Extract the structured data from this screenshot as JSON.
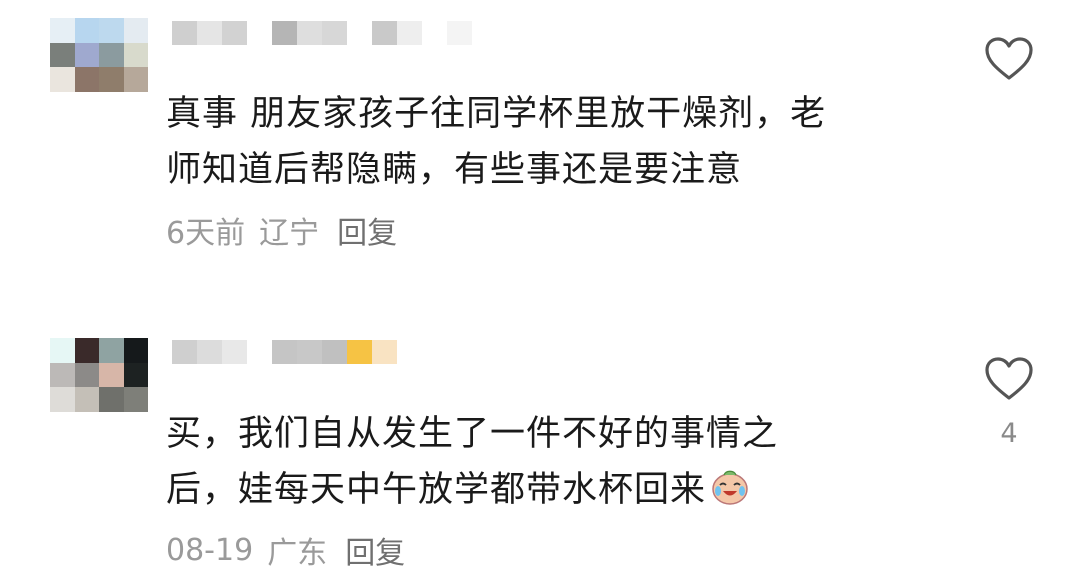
{
  "comments": [
    {
      "text_line1": "真事 朋友家孩子往同学杯里放干燥剂，老",
      "text_line2": "师知道后帮隐瞒，有些事还是要注意",
      "time": "6天前",
      "location": "辽宁",
      "reply_label": "回复",
      "like_count": "",
      "avatar_pixels": [
        "#e6eff5",
        "#b7d6ef",
        "#bdd9ee",
        "#e4ebf1",
        "#7a7f7b",
        "#9fa9cf",
        "#8b9b9f",
        "#d8dacc",
        "#eae5de",
        "#8c7568",
        "#8f7d6b",
        "#b6a89a"
      ],
      "username_pixels": [
        "#cfcfcf",
        "#e5e5e5",
        "#d2d2d2",
        "#ffffff",
        "#b5b5b5",
        "#dedede",
        "#d7d7d7",
        "#ffffff",
        "#c9c9c9",
        "#eeeeee",
        "#ffffff",
        "#f4f4f4"
      ]
    },
    {
      "text_line1": "买，我们自从发生了一件不好的事情之",
      "text_line2": "后，娃每天中午放学都带水杯回来",
      "time": "08-19",
      "location": "广东",
      "reply_label": "回复",
      "like_count": "4",
      "emoji": "crying-laughing-emoji",
      "avatar_pixels": [
        "#e6f7f5",
        "#3a2a2a",
        "#8fa3a2",
        "#15191b",
        "#bcb9b7",
        "#8c8a88",
        "#d7b6a8",
        "#1d2222",
        "#dedcd8",
        "#c4bfb7",
        "#6f706b",
        "#7e7f79"
      ],
      "username_pixels": [
        "#cfcfcf",
        "#dcdcdc",
        "#e8e8e8",
        "#ffffff",
        "#c5c5c5",
        "#c8c8c8",
        "#c0c0c0",
        "#f6c344",
        "#f9e3c2",
        "#ffffff"
      ]
    }
  ]
}
